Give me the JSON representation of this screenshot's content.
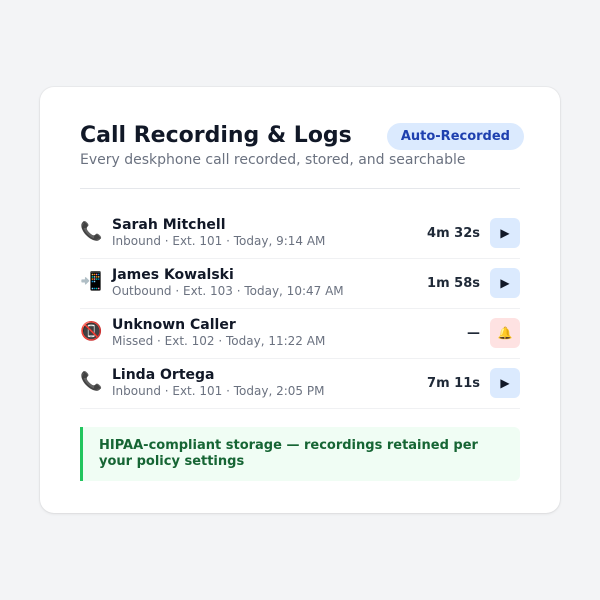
{
  "header": {
    "title": "Call Recording & Logs",
    "subtitle": "Every deskphone call recorded, stored, and searchable",
    "badge": "Auto-Recorded"
  },
  "calls": [
    {
      "icon": "phone-icon",
      "icon_glyph": "📞",
      "caller": "Sarah Mitchell",
      "meta": "Inbound · Ext. 101 · Today, 9:14 AM",
      "duration": "4m 32s",
      "action_icon": "play-icon",
      "action_glyph": "▶"
    },
    {
      "icon": "outgoing-call-icon",
      "icon_glyph": "📲",
      "caller": "James Kowalski",
      "meta": "Outbound · Ext. 103 · Today, 10:47 AM",
      "duration": "1m 58s",
      "action_icon": "play-icon",
      "action_glyph": "▶"
    },
    {
      "icon": "missed-call-icon",
      "icon_glyph": "📵",
      "caller": "Unknown Caller",
      "meta": "Missed · Ext. 102 · Today, 11:22 AM",
      "duration": "—",
      "action_icon": "bell-icon",
      "action_glyph": "🔔"
    },
    {
      "icon": "phone-icon",
      "icon_glyph": "📞",
      "caller": "Linda Ortega",
      "meta": "Inbound · Ext. 101 · Today, 2:05 PM",
      "duration": "7m 11s",
      "action_icon": "play-icon",
      "action_glyph": "▶"
    }
  ],
  "notice": {
    "text": "HIPAA-compliant storage — recordings retained per your policy settings"
  },
  "colors": {
    "accent": "#1e40af",
    "badge_bg": "#dbeafe",
    "missed_bg": "#fee2e2",
    "notice_border": "#22c55e",
    "notice_text": "#166534"
  }
}
